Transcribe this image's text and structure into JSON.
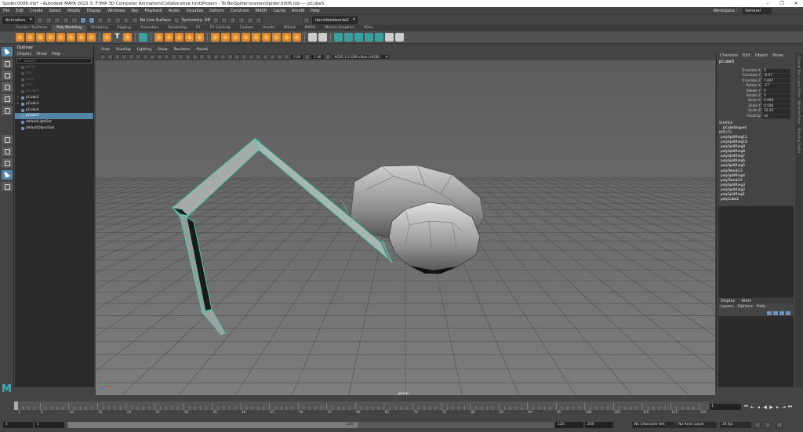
{
  "titlebar": {
    "text": "Spider.0006.mb* - Autodesk MAYA 2022.3: F:\\MA 3D Computer Animation\\Collaborative Unit\\Project - To Be\\Spider\\scenes\\Spider.0006.mb --- pCube5"
  },
  "menus": [
    "File",
    "Edit",
    "Create",
    "Select",
    "Modify",
    "Display",
    "Windows",
    "Key",
    "Playback",
    "Audio",
    "Visualize",
    "Deform",
    "Constrain",
    "MASH",
    "Cache",
    "Arnold",
    "Help"
  ],
  "workspace": {
    "label": "Workspace :",
    "value": "General"
  },
  "status_line": {
    "menu_set": "Animation",
    "live_surface": "No Live Surface",
    "symmetry": "Symmetry: Off",
    "user": "danielbedwards2"
  },
  "shelf_tabs": [
    "Curves / Surfaces",
    "Poly Modeling",
    "Sculpting",
    "Rigging",
    "Animation",
    "Rendering",
    "FX",
    "FX Caching",
    "Custom",
    "Arnold",
    "Bifrost",
    "MASH",
    "Motion Graphics",
    "XGen"
  ],
  "shelf_active": "Poly Modeling",
  "outliner": {
    "title": "Outliner",
    "menus": [
      "Display",
      "Show",
      "Help"
    ],
    "search_placeholder": "Search...",
    "items": [
      {
        "label": "persp",
        "dim": true
      },
      {
        "label": "top",
        "dim": true
      },
      {
        "label": "front",
        "dim": true
      },
      {
        "label": "side",
        "dim": true
      },
      {
        "label": "pCube1",
        "dim": true
      },
      {
        "label": "pCube2",
        "dim": false
      },
      {
        "label": "pCube3",
        "dim": false
      },
      {
        "label": "pCube4",
        "dim": false
      },
      {
        "label": "pCube5",
        "dim": false,
        "selected": true
      },
      {
        "label": "defaultLightSet",
        "dim": false
      },
      {
        "label": "defaultObjectSet",
        "dim": false
      }
    ]
  },
  "viewport": {
    "menus": [
      "View",
      "Shading",
      "Lighting",
      "Show",
      "Renderer",
      "Panels"
    ],
    "near_value": "0.00",
    "far_value": "1.00",
    "color_space": "ACES 1.0 SDR-video (sRGB)",
    "camera_label": "persp"
  },
  "channel_box": {
    "tabs": [
      "Channels",
      "Edit",
      "Object",
      "Show"
    ],
    "object": "pCube5",
    "attributes": [
      {
        "name": "Translate X",
        "value": "0"
      },
      {
        "name": "Translate Y",
        "value": "-0.67"
      },
      {
        "name": "Translate Z",
        "value": "7.097"
      },
      {
        "name": "Rotate X",
        "value": "-17"
      },
      {
        "name": "Rotate Y",
        "value": "0"
      },
      {
        "name": "Rotate Z",
        "value": "0"
      },
      {
        "name": "Scale X",
        "value": "0.994"
      },
      {
        "name": "Scale Y",
        "value": "0.594"
      },
      {
        "name": "Scale Z",
        "value": "10.25"
      },
      {
        "name": "Visibility",
        "value": "on"
      }
    ],
    "shapes_label": "SHAPES",
    "shape": "pCubeShape4",
    "inputs_label": "INPUTS",
    "inputs": [
      "polySplitRing11",
      "polySplitRing10",
      "polySplitRing9",
      "polySplitRing8",
      "polySplitRing7",
      "polySplitRing6",
      "polySplitRing5",
      "polyTweak13",
      "polySplitRing4",
      "polyTweak12",
      "polySplitRing3",
      "polySplitRing2",
      "polySplitRing1",
      "polyCube2"
    ]
  },
  "layers": {
    "tabs": [
      "Display",
      "Anim"
    ],
    "menus": [
      "Layers",
      "Options",
      "Help"
    ]
  },
  "side_strip": [
    "Channel Box / Layer Editor",
    "Attribute Editor",
    "Modeling Toolkit"
  ],
  "timeline": {
    "current_frame": "1",
    "ticks": [
      "1",
      "5",
      "10",
      "15",
      "20",
      "25",
      "30",
      "35",
      "40",
      "45",
      "50",
      "55",
      "60",
      "65",
      "70",
      "75",
      "80",
      "85",
      "90",
      "95",
      "100",
      "105",
      "110",
      "115",
      "120"
    ]
  },
  "range": {
    "start": "1",
    "start_inner": "1",
    "end_inner": "120",
    "end": "120",
    "end_outer": "200",
    "char_set": "No Character Set",
    "anim_layer": "No Anim Layer",
    "fps": "24 fps"
  },
  "colors": {
    "selection": "#5285a6",
    "wireframe_highlight": "#3fd6b0",
    "viewport_bg": "#777777",
    "maya_logo": "#37b2c4"
  }
}
